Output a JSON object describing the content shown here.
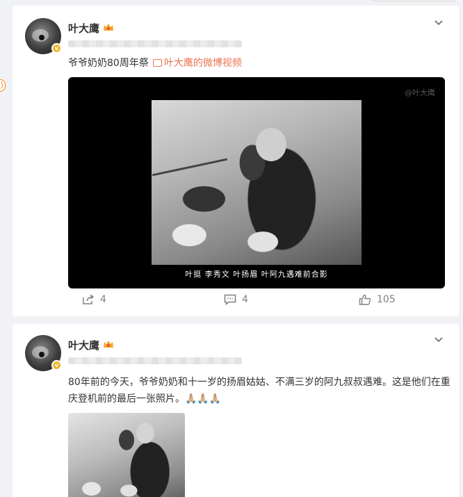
{
  "posts": [
    {
      "username": "叶大鹰",
      "text": "爷爷奶奶80周年祭",
      "video_link": "叶大鹰的微博视频",
      "video_subtitle": "叶挺  李秀文  叶扬眉  叶阿九遇难前合影",
      "video_watermark": "@叶大鹰",
      "actions": {
        "share": "4",
        "comment": "4",
        "like": "105"
      }
    },
    {
      "username": "叶大鹰",
      "text": "80年前的今天，爷爷奶奶和十一岁的扬眉姑姑、不满三岁的阿九叔叔遇难。这是他们在重庆登机前的最后一张照片。🙏🏼🙏🏼🙏🏼"
    }
  ],
  "colors": {
    "accent": "#eb7350",
    "verified": "#f2b632",
    "page_bg": "#f1f2f5"
  },
  "icons": [
    "share-icon",
    "comment-icon",
    "like-icon",
    "chevron-down-icon",
    "crown-badge-icon",
    "verified-badge-icon",
    "video-icon"
  ]
}
